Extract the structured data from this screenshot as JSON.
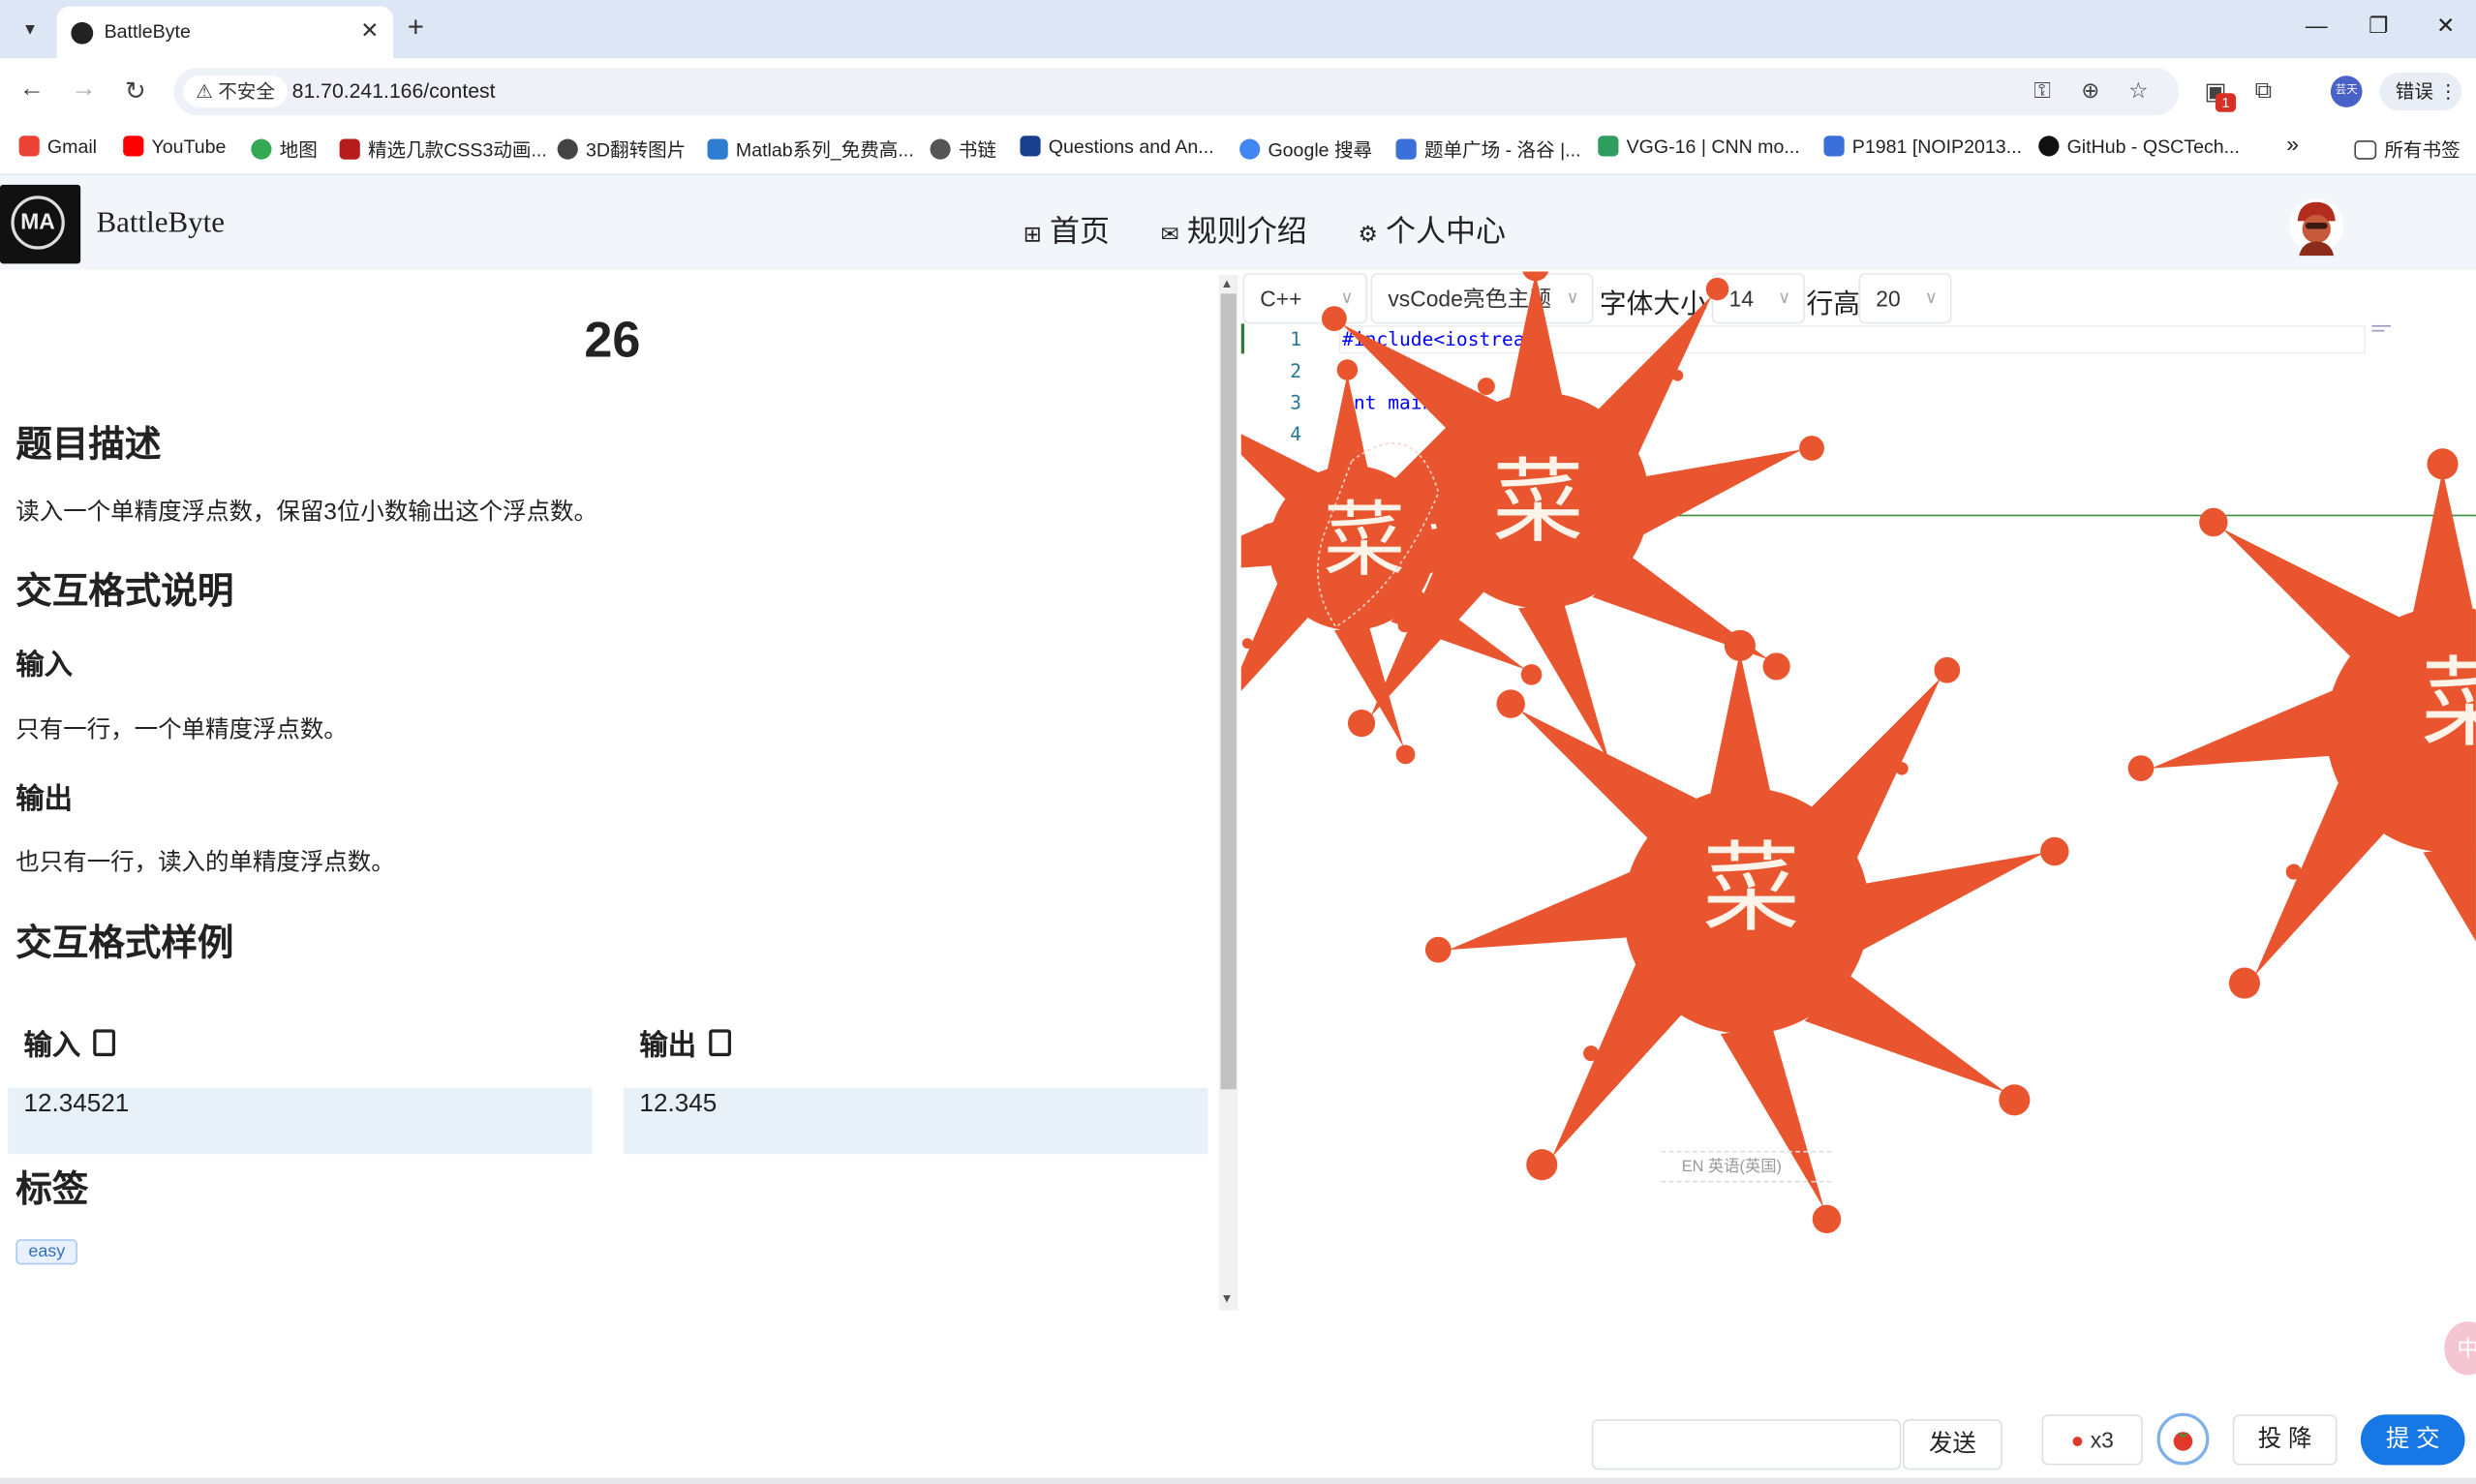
{
  "browser": {
    "tab_title": "BattleByte",
    "secure_label": "不安全",
    "url": "81.70.241.166/contest",
    "profile_label": "芸天",
    "error_button": "错误",
    "extension_badge": "1",
    "bookmarks": [
      {
        "label": "Gmail",
        "color": "#ea4335"
      },
      {
        "label": "YouTube",
        "color": "#ff0000"
      },
      {
        "label": "地图",
        "color": "#34a853"
      },
      {
        "label": "精选几款CSS3动画...",
        "color": "#b71c1c"
      },
      {
        "label": "3D翻转图片",
        "color": "#444444"
      },
      {
        "label": "Matlab系列_免费高...",
        "color": "#2e7dd1"
      },
      {
        "label": "书链",
        "color": "#555555"
      },
      {
        "label": "Questions and An...",
        "color": "#1a3f8f"
      },
      {
        "label": "Google 搜尋",
        "color": "#4285f4"
      },
      {
        "label": "题单广场 - 洛谷 |...",
        "color": "#3b6fd9"
      },
      {
        "label": "VGG-16 | CNN mo...",
        "color": "#2e9d5e"
      },
      {
        "label": "P1981 [NOIP2013...",
        "color": "#3b6fd9"
      },
      {
        "label": "GitHub - QSCTech...",
        "color": "#111111"
      }
    ],
    "all_bookmarks": "所有书签"
  },
  "app": {
    "brand": "BattleByte",
    "nav": [
      {
        "label": "首页",
        "icon": "grid-icon"
      },
      {
        "label": "规则介绍",
        "icon": "mail-icon"
      },
      {
        "label": "个人中心",
        "icon": "gear-icon"
      }
    ]
  },
  "problem": {
    "number": "26",
    "desc_heading": "题目描述",
    "desc_text": "读入一个单精度浮点数，保留3位小数输出这个浮点数。",
    "format_heading": "交互格式说明",
    "input_heading": "输入",
    "input_text": "只有一行，一个单精度浮点数。",
    "output_heading": "输出",
    "output_text": "也只有一行，读入的单精度浮点数。",
    "sample_heading": "交互格式样例",
    "sample_input_label": "输入",
    "sample_output_label": "输出",
    "sample_input": "12.34521",
    "sample_output": "12.345",
    "tags_heading": "标签",
    "tags": [
      "easy"
    ]
  },
  "editor": {
    "language": "C++",
    "theme": "vsCode亮色主题",
    "font_size_label": "字体大小",
    "font_size": "14",
    "line_height_label": "行高",
    "line_height": "20",
    "lines": [
      {
        "num": "1",
        "text": "#include<iostream>"
      },
      {
        "num": "2",
        "text": ""
      },
      {
        "num": "3",
        "text": "int main()"
      },
      {
        "num": "4",
        "text": "{"
      }
    ],
    "splat_text": "菜",
    "splat_color": "#e8552e",
    "ime_label": "EN 英语(英国)"
  },
  "bottom": {
    "send": "发送",
    "tomato_count": "x3",
    "surrender": "投 降",
    "submit": "提 交",
    "side_bubble": "中"
  }
}
